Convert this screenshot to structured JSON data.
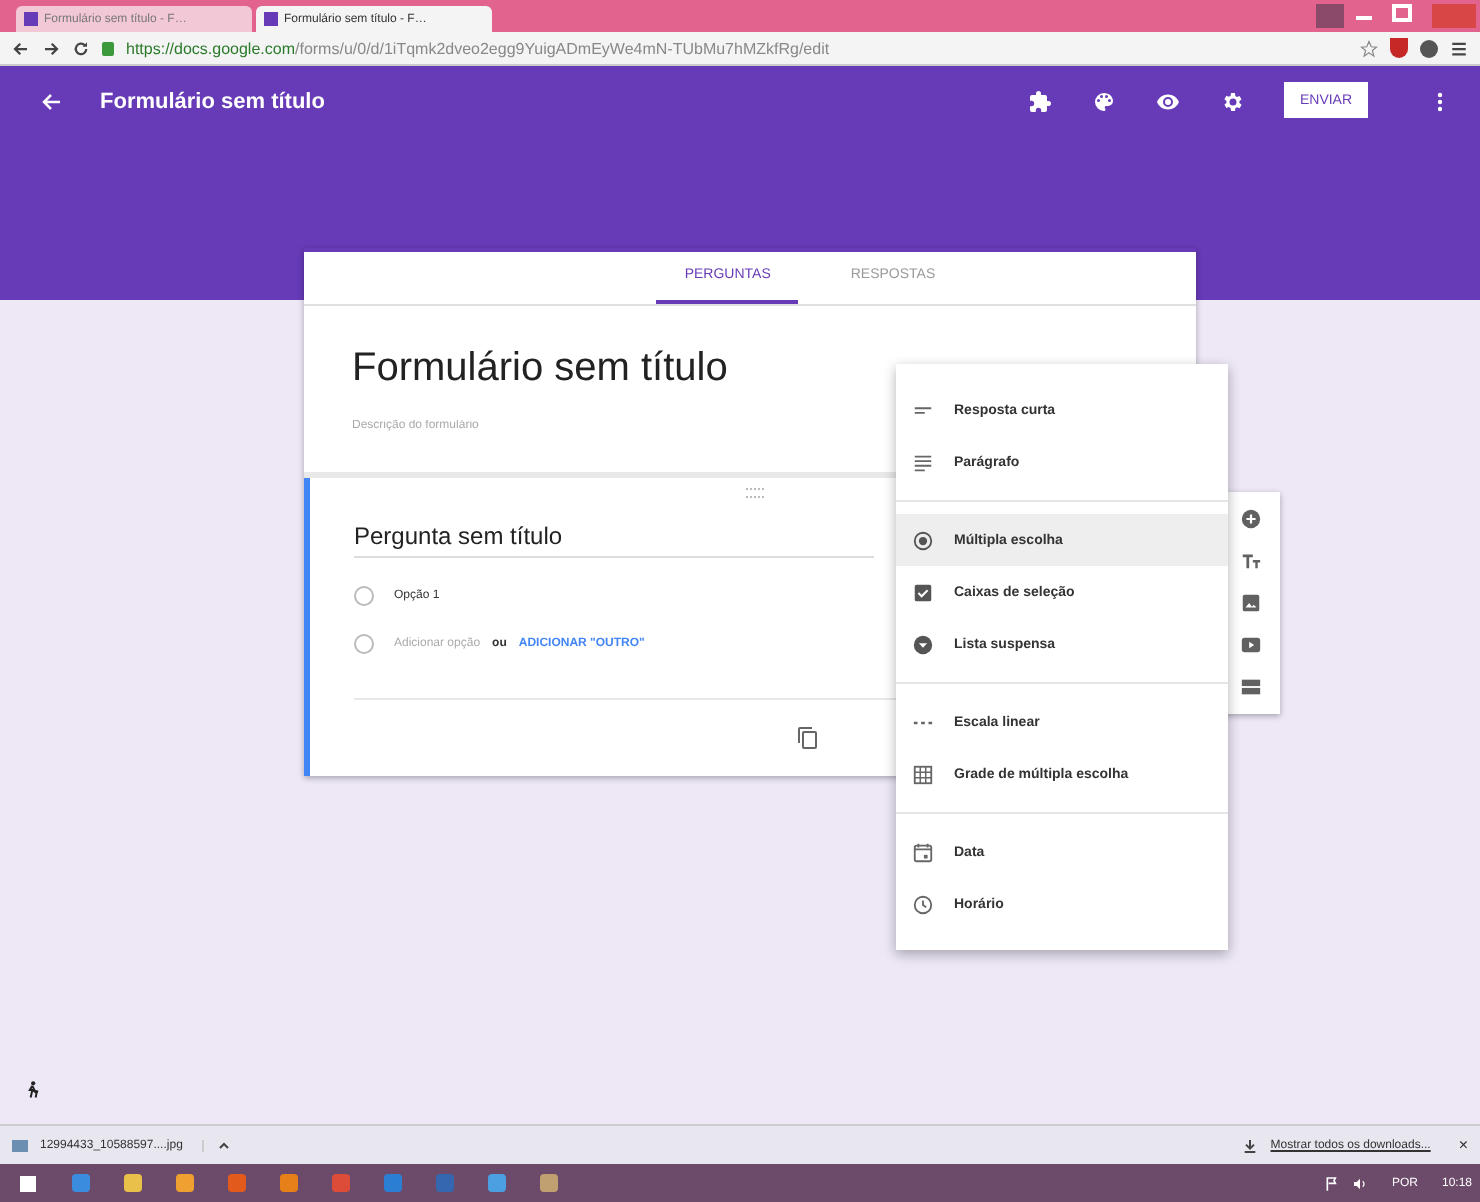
{
  "browser": {
    "tabs": [
      {
        "label": "Formulário sem título - F…",
        "selected": false
      },
      {
        "label": "Formulário sem título - F…",
        "selected": true
      }
    ],
    "url_host": "https://docs.google.com",
    "url_path": "/forms/u/0/d/1iTqmk2dveo2egg9YuigADmEyWe4mN-TUbMu7hMZkfRg/edit"
  },
  "header": {
    "title": "Formulário sem título",
    "send_button": "ENVIAR"
  },
  "form_tabs": [
    {
      "label": "PERGUNTAS",
      "selected": true
    },
    {
      "label": "RESPOSTAS",
      "selected": false
    }
  ],
  "form": {
    "title": "Formulário sem título",
    "description_placeholder": "Descrição do formulário"
  },
  "question": {
    "title": "Pergunta sem título",
    "options": [
      "Opção 1"
    ],
    "add_option": "Adicionar opção",
    "or": "ou",
    "add_other": "ADICIONAR \"OUTRO\""
  },
  "type_menu": [
    [
      {
        "kind": "short",
        "label": "Resposta curta",
        "selected": false
      },
      {
        "kind": "paragraph",
        "label": "Parágrafo",
        "selected": false
      }
    ],
    [
      {
        "kind": "radio",
        "label": "Múltipla escolha",
        "selected": true
      },
      {
        "kind": "checkbox",
        "label": "Caixas de seleção",
        "selected": false
      },
      {
        "kind": "dropdown",
        "label": "Lista suspensa",
        "selected": false
      }
    ],
    [
      {
        "kind": "scale",
        "label": "Escala linear",
        "selected": false
      },
      {
        "kind": "grid",
        "label": "Grade de múltipla escolha",
        "selected": false
      }
    ],
    [
      {
        "kind": "date",
        "label": "Data",
        "selected": false
      },
      {
        "kind": "time",
        "label": "Horário",
        "selected": false
      }
    ]
  ],
  "downloads": {
    "file": "12994433_10588597....jpg",
    "show_all": "Mostrar todos os downloads...",
    "close": "×"
  },
  "taskbar": {
    "language": "POR",
    "time": "10:18"
  }
}
